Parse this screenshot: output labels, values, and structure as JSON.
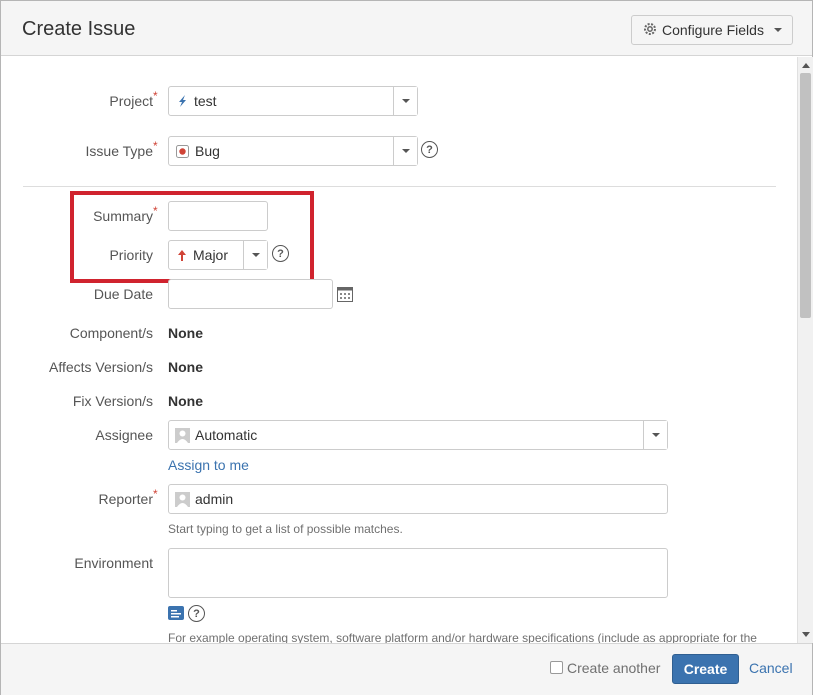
{
  "dialog": {
    "title": "Create Issue",
    "configure_fields_label": "Configure Fields"
  },
  "form": {
    "project": {
      "label": "Project",
      "value": "test"
    },
    "issue_type": {
      "label": "Issue Type",
      "value": "Bug"
    },
    "summary": {
      "label": "Summary",
      "value": ""
    },
    "priority": {
      "label": "Priority",
      "value": "Major"
    },
    "due_date": {
      "label": "Due Date",
      "value": ""
    },
    "components": {
      "label": "Component/s",
      "value": "None"
    },
    "affects_versions": {
      "label": "Affects Version/s",
      "value": "None"
    },
    "fix_versions": {
      "label": "Fix Version/s",
      "value": "None"
    },
    "assignee": {
      "label": "Assignee",
      "value": "Automatic",
      "assign_to_me": "Assign to me"
    },
    "reporter": {
      "label": "Reporter",
      "value": "admin",
      "hint": "Start typing to get a list of possible matches."
    },
    "environment": {
      "label": "Environment",
      "value": "",
      "hint": "For example operating system, software platform and/or hardware specifications (include as appropriate for the"
    }
  },
  "footer": {
    "create_another_label": "Create another",
    "create_another_checked": false,
    "create_label": "Create",
    "cancel_label": "Cancel"
  },
  "colors": {
    "accent": "#3b73af",
    "required": "#d04437",
    "highlight": "#d0232e"
  },
  "icons": {
    "configure": "gear-icon",
    "project": "project-avatar-icon",
    "issue_type": "bug-icon",
    "priority": "priority-major-arrow-icon",
    "calendar": "calendar-icon",
    "assignee": "user-avatar-icon",
    "reporter": "user-avatar-icon",
    "wiki": "wiki-style-icon",
    "help": "help-icon"
  }
}
